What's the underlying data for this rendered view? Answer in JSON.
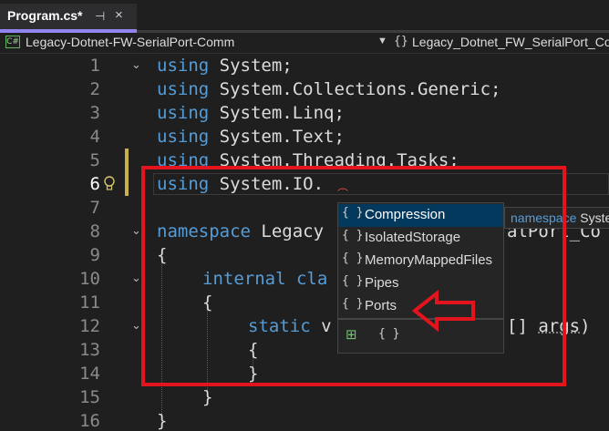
{
  "tab": {
    "title": "Program.cs*",
    "pin_icon": "pin-icon",
    "close_icon": "close-icon"
  },
  "navbar": {
    "project_badge": "C#",
    "project": "Legacy-Dotnet-FW-SerialPort-Comm",
    "namespace": "Legacy_Dotnet_FW_SerialPort_Comm"
  },
  "editor": {
    "lines": [
      {
        "n": "1",
        "kw": "using",
        "rest": " System;"
      },
      {
        "n": "2",
        "kw": "using",
        "rest": " System.Collections.Generic;"
      },
      {
        "n": "3",
        "kw": "using",
        "rest": " System.Linq;"
      },
      {
        "n": "4",
        "kw": "using",
        "rest": " System.Text;"
      },
      {
        "n": "5",
        "kw": "using",
        "rest": " System.Threading.Tasks;"
      },
      {
        "n": "6",
        "kw": "using",
        "rest": " System.IO."
      },
      {
        "n": "7",
        "kw": "",
        "rest": ""
      },
      {
        "n": "8",
        "kw": "namespace",
        "rest": " Legacy"
      },
      {
        "n": "9",
        "kw": "",
        "rest": "{"
      },
      {
        "n": "10",
        "kw": "internal",
        "rest": " cla"
      },
      {
        "n": "11",
        "kw": "",
        "rest": "{"
      },
      {
        "n": "12",
        "kw": "static",
        "rest": " v"
      },
      {
        "n": "13",
        "kw": "",
        "rest": "{"
      },
      {
        "n": "14",
        "kw": "",
        "rest": "}"
      },
      {
        "n": "15",
        "kw": "",
        "rest": "}"
      },
      {
        "n": "16",
        "kw": "",
        "rest": "}"
      }
    ],
    "line8_tail": "alPort_Co",
    "line12_tail_a": "[] ",
    "line12_tail_b": "args",
    "line12_tail_c": ")"
  },
  "intellisense": {
    "items": [
      {
        "icon": "{ }",
        "label": "Compression"
      },
      {
        "icon": "{ }",
        "label": "IsolatedStorage"
      },
      {
        "icon": "{ }",
        "label": "MemoryMappedFiles"
      },
      {
        "icon": "{ }",
        "label": "Pipes"
      },
      {
        "icon": "{ }",
        "label": "Ports"
      }
    ],
    "selected_index": 0,
    "filter_namespace_icon": "{ }",
    "filter_expand_icon": "⊞"
  },
  "tooltip": {
    "keyword": "namespace",
    "name": " System.IO.Compression"
  },
  "colors": {
    "keyword": "#569cd6",
    "annotation": "#e3141e",
    "tab_accent": "#9184ee"
  }
}
